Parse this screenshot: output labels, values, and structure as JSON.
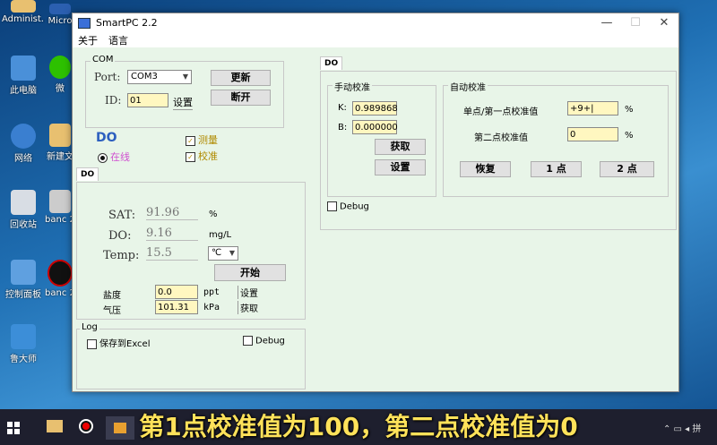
{
  "desktop": {
    "icons_left": [
      {
        "label": "Administ...",
        "top": 0
      },
      {
        "label": "此电脑",
        "top": 0
      },
      {
        "label": "网络",
        "top": 0
      },
      {
        "label": "回收站",
        "top": 0
      },
      {
        "label": "控制面板",
        "top": 0
      },
      {
        "label": "鲁大师",
        "top": 0
      }
    ],
    "icons_right": [
      {
        "label": "Micro"
      },
      {
        "label": "微"
      },
      {
        "label": "新建文"
      },
      {
        "label": "banc 2021"
      },
      {
        "label": "banc 2021"
      }
    ]
  },
  "window": {
    "title": "SmartPC 2.2",
    "menu": [
      "关于",
      "语言"
    ]
  },
  "com": {
    "group_title": "COM",
    "port_label": "Port:",
    "port_value": "COM3",
    "id_label": "ID:",
    "id_value": "01",
    "set_label": "设置",
    "refresh_label": "更新",
    "disconnect_label": "断开"
  },
  "do_status": {
    "title": "DO",
    "online_label": "在线",
    "measure_label": "测量",
    "calibrate_label": "校准"
  },
  "do_tab": {
    "tab_label": "DO",
    "sat_label": "SAT:",
    "sat_value": "91.96",
    "sat_unit": "%",
    "do_label": "DO:",
    "do_value": "9.16",
    "do_unit": "mg/L",
    "temp_label": "Temp:",
    "temp_value": "15.5",
    "temp_unit": "℃",
    "start_label": "开始",
    "salinity_label": "盐度",
    "salinity_value": "0.0",
    "salinity_unit": "ppt",
    "salinity_set": "设置",
    "pressure_label": "气压",
    "pressure_value": "101.31",
    "pressure_unit": "kPa",
    "pressure_get": "获取"
  },
  "log": {
    "title": "Log",
    "save_excel": "保存到Excel",
    "debug": "Debug"
  },
  "calib_tab": {
    "tab_label": "DO",
    "manual": {
      "title": "手动校准",
      "k_label": "K:",
      "k_value": "0.989868",
      "b_label": "B:",
      "b_value": "0.000000",
      "get_label": "获取",
      "set_label": "设置"
    },
    "auto": {
      "title": "自动校准",
      "point1_label": "单点/第一点校准值",
      "point1_value": "+9+|",
      "point1_unit": "%",
      "point2_label": "第二点校准值",
      "point2_value": "0",
      "point2_unit": "%",
      "restore_label": "恢复",
      "one_point_label": "1 点",
      "two_point_label": "2 点"
    },
    "debug": "Debug"
  },
  "caption": "第1点校准值为100，第二点校准值为0"
}
